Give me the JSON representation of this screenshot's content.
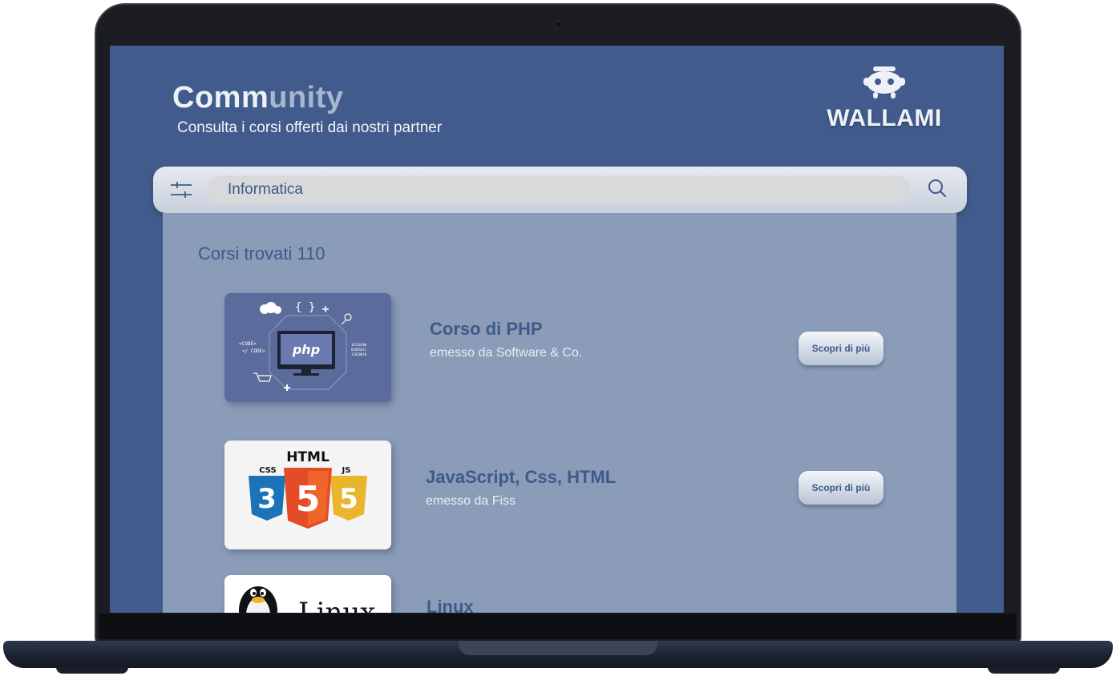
{
  "header": {
    "title_main": "Comm",
    "title_fade": "unity",
    "subtitle": "Consulta i corsi offerti dai nostri partner"
  },
  "brand": {
    "name": "WALLAMI",
    "icon": "robot-mascot-icon"
  },
  "search": {
    "value": "Informatica",
    "filter_icon": "sliders-icon",
    "search_icon": "magnifier-icon"
  },
  "results": {
    "count_label": "Corsi trovati 110",
    "courses": [
      {
        "title": "Corso di PHP",
        "issuer": "emesso da Software & Co.",
        "button": "Scopri di più",
        "thumbnail_text": "php"
      },
      {
        "title": "JavaScript, Css, HTML",
        "issuer": "emesso da Fiss",
        "button": "Scopri di più",
        "thumbnail_text": "HTML",
        "badges": [
          "CSS",
          "JS"
        ]
      },
      {
        "title": "Linux",
        "thumbnail_text": "Linux"
      }
    ]
  },
  "colors": {
    "screen_bg": "#415c8c",
    "panel_bg": "#8a9cb8",
    "accent_text": "#3e5a8a"
  }
}
